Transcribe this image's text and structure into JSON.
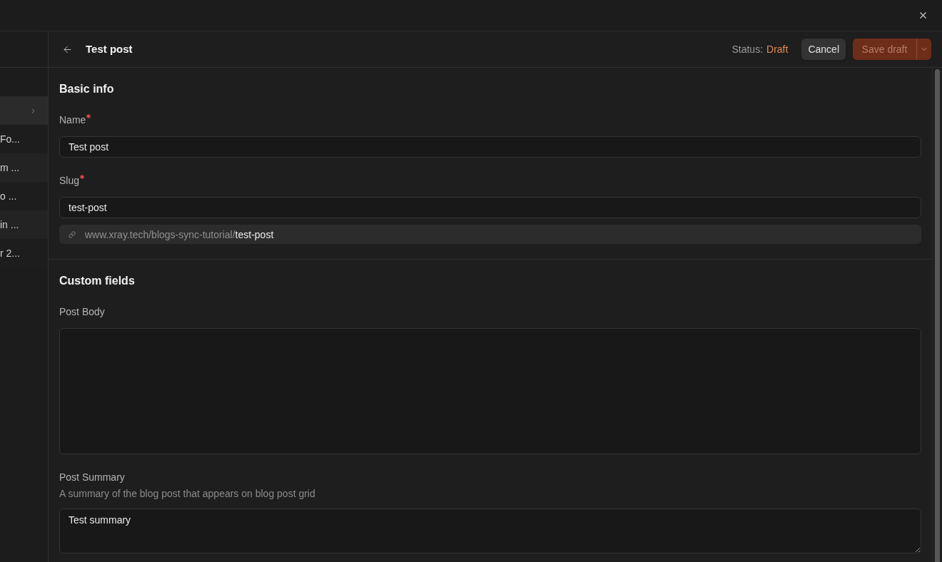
{
  "sidebar": {
    "items": [
      {
        "selected": true
      },
      {
        "label": "Fo...",
        "selected": false
      },
      {
        "label": "m ...",
        "selected": false
      },
      {
        "label": "o ...",
        "selected": false
      },
      {
        "label": "in ...",
        "selected": false
      },
      {
        "label": "r 2...",
        "selected": false
      }
    ]
  },
  "editor": {
    "title": "Test post",
    "status": {
      "label": "Status:",
      "value": "Draft"
    },
    "actions": [
      {
        "kind": "secondary",
        "label": "Cancel",
        "disabled": false
      },
      {
        "kind": "split",
        "label": "Save draft",
        "disabled": true
      }
    ],
    "sections": [
      {
        "title": "Basic info",
        "fields": [
          {
            "kind": "input",
            "label": "Name",
            "required": true,
            "value": "Test post"
          },
          {
            "kind": "input",
            "label": "Slug",
            "required": true,
            "value": "test-post",
            "url_preview": {
              "base": "www.xray.tech/blogs-sync-tutorial/",
              "slug": "test-post"
            }
          }
        ]
      },
      {
        "title": "Custom fields",
        "fields": [
          {
            "kind": "editor",
            "label": "Post Body",
            "required": false
          },
          {
            "kind": "textarea",
            "label": "Post Summary",
            "required": false,
            "description": "A summary of the blog post that appears on blog post grid",
            "value": "Test summary"
          }
        ]
      }
    ]
  }
}
